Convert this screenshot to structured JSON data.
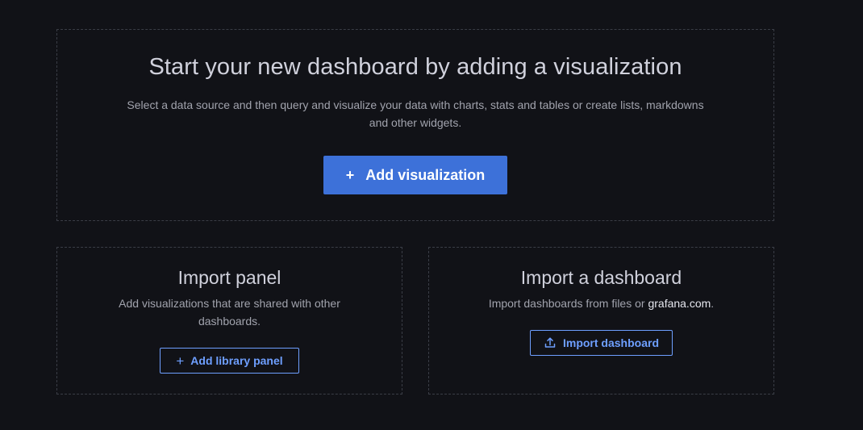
{
  "hero": {
    "title": "Start your new dashboard by adding a visualization",
    "description": "Select a data source and then query and visualize your data with charts, stats and tables or create lists, markdowns and other widgets.",
    "add_visualization_label": "Add visualization",
    "plus_icon": "+"
  },
  "import_panel": {
    "title": "Import panel",
    "description": "Add visualizations that are shared with other dashboards.",
    "button_label": "Add library panel",
    "plus_icon": "+"
  },
  "import_dashboard": {
    "title": "Import a dashboard",
    "description_prefix": "Import dashboards from files or ",
    "link_text": "grafana.com",
    "description_suffix": ".",
    "button_label": "Import dashboard",
    "upload_icon": "upload-icon"
  },
  "colors": {
    "background": "#111217",
    "primary": "#3d71d9",
    "link_blue": "#6e9fff",
    "border": "#3a3d46"
  }
}
